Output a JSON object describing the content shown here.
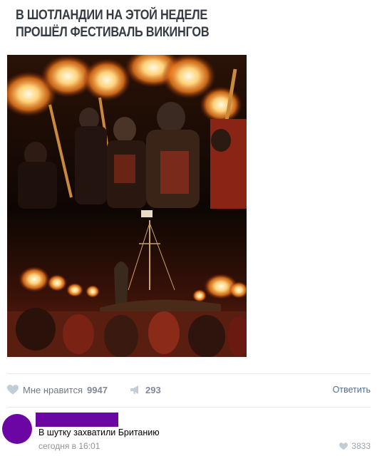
{
  "post": {
    "headline_line1": "В ШОТЛАНДИИ НА ЭТОЙ НЕДЕЛЕ",
    "headline_line2": "ПРОШЁЛ  ФЕСТИВАЛЬ ВИКИНГОВ"
  },
  "actions": {
    "like_label": "Мне нравится",
    "like_count": "9947",
    "share_count": "293",
    "reply_label": "Ответить"
  },
  "comment": {
    "text": "В шутку захватили Британию",
    "time": "сегодня в 16:01",
    "like_count": "3833"
  },
  "colors": {
    "avatar": "#6b06a4",
    "link": "#4f6d92",
    "muted": "#6f7a87"
  },
  "icons": {
    "like": "heart-icon",
    "share": "megaphone-icon",
    "comment_like": "heart-icon"
  }
}
